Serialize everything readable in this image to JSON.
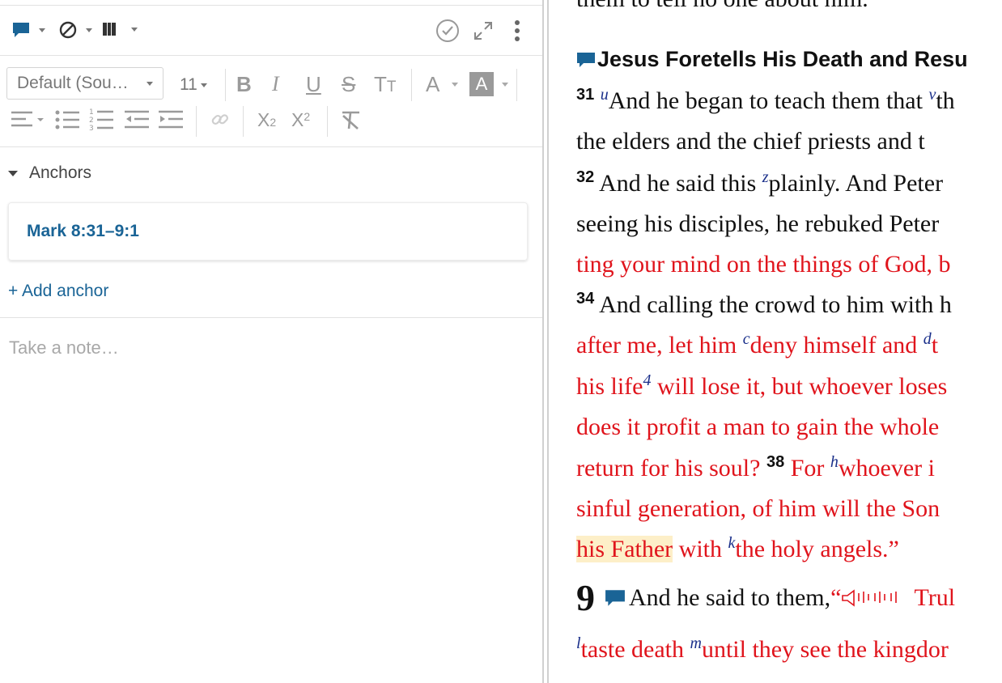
{
  "toolbar": {
    "icons": [
      "note-icon",
      "prohibited-icon",
      "book-icon",
      "check-circle-icon",
      "expand-icon",
      "more-vertical-icon"
    ],
    "accent": "#1a6496"
  },
  "format": {
    "font": "Default (Sou…",
    "size": "11"
  },
  "anchors": {
    "title": "Anchors",
    "items": [
      "Mark 8:31–9:1"
    ],
    "add_label": "+ Add anchor"
  },
  "note": {
    "placeholder": "Take a note…"
  },
  "reader": {
    "top_partial": "them to tell no one about him.",
    "heading": "Jesus Foretells His Death and Resu",
    "lines": [
      {
        "vn": "31",
        "xr": "u",
        "t1": "And he began to teach them that ",
        "xr2": "v",
        "t2": "th"
      },
      {
        "t": "the elders and the chief priests and t"
      },
      {
        "vn": "32",
        "t1": " And he said this ",
        "xr": "z",
        "t2": "plainly. And Peter"
      },
      {
        "t": "seeing his disciples, he rebuked Peter"
      },
      {
        "red": "ting your mind on the things of God, b"
      },
      {
        "vn": "34",
        "t": " And calling the crowd to him with h"
      },
      {
        "r1": "after me, let him ",
        "xr": "c",
        "r2": "deny himself and ",
        "xr2": "d",
        "r3": "t"
      },
      {
        "r1": "his life",
        "xr": "4",
        "r2": " will lose it, but whoever loses"
      },
      {
        "red": "does it profit a man to gain the whole"
      },
      {
        "r1": "return for his soul? ",
        "vn": "38",
        "r2": " For ",
        "xr": "h",
        "r3": "whoever i"
      },
      {
        "red": "sinful generation, of him will the Son"
      },
      {
        "hl": "his Father",
        "r1": " with ",
        "xr": "k",
        "r2": "the holy angels.”"
      },
      {
        "chap": "9",
        "t": "And he said to them, ",
        "q": "“",
        "r": "Trul"
      },
      {
        "xr": "l",
        "r1": "taste death ",
        "xr2": "m",
        "r2": "until they see the kingdor"
      }
    ]
  }
}
